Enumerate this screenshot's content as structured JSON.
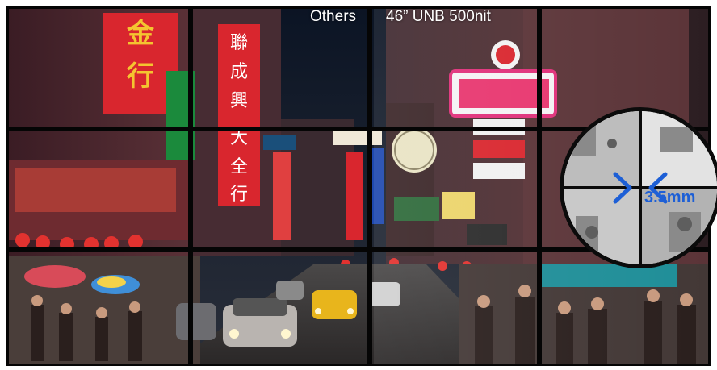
{
  "labels": {
    "others": "Others",
    "model": "46” UNB 500nit"
  },
  "zoom": {
    "bezel_width": "3.5mm"
  },
  "colors": {
    "bezel_arrow": "#1d5fd6",
    "sign_red": "#d9262e",
    "sign_gold": "#f4c430",
    "sign_green": "#1b8a3c",
    "sky": "#0b1424"
  },
  "icons": [
    "chevron-right-icon",
    "chevron-left-icon"
  ]
}
